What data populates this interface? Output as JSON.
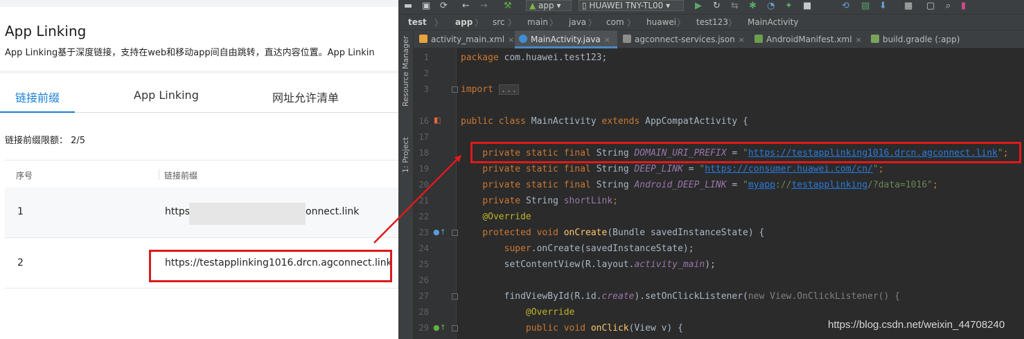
{
  "console": {
    "title": "App Linking",
    "description": "App Linking基于深度链接，支持在web和移动app间自由跳转，直达内容位置。App Linkin",
    "tabs": [
      {
        "label": "链接前缀",
        "active": true
      },
      {
        "label": "App Linking",
        "active": false
      },
      {
        "label": "网址允许清单",
        "active": false
      }
    ],
    "quota_label": "链接前缀限额：",
    "quota_value": "2/5",
    "table": {
      "headers": [
        "序号",
        "链接前缀"
      ],
      "rows": [
        {
          "index": "1",
          "prefix_start": "https:/",
          "prefix_end": "onnect.link"
        },
        {
          "index": "2",
          "prefix": "https://testapplinking1016.drcn.agconnect.link"
        }
      ]
    }
  },
  "ide": {
    "toolbar": {
      "module": "app",
      "device": "HUAWEI TNY-TL00"
    },
    "breadcrumb": [
      "test",
      "app",
      "src",
      "main",
      "java",
      "com",
      "huawei",
      "test123",
      "MainActivity"
    ],
    "sidebar_labels": [
      "Resource Manager",
      "1: Project"
    ],
    "tabs": [
      {
        "label": "activity_main.xml",
        "active": false,
        "icon_color": "#e8a33d"
      },
      {
        "label": "MainActivity.java",
        "active": true,
        "icon_color": "#3f8fd2"
      },
      {
        "label": "agconnect-services.json",
        "active": false,
        "icon_color": "#8c8c8c"
      },
      {
        "label": "AndroidManifest.xml",
        "active": false,
        "icon_color": "#6a9f4f"
      },
      {
        "label": "build.gradle (:app)",
        "active": false,
        "icon_color": "#7aa35a"
      }
    ],
    "line_numbers": [
      "1",
      "2",
      "3",
      "16",
      "17",
      "18",
      "19",
      "20",
      "21",
      "22",
      "23",
      "24",
      "25",
      "26",
      "27",
      "28",
      "29"
    ],
    "code": {
      "package_name": "com.huawei.test123;",
      "import_fold": "...",
      "class_name": "MainActivity",
      "super_class": "AppCompatActivity",
      "domain_const": "DOMAIN_URI_PREFIX",
      "domain_url": "https://testapplinking1016.drcn.agconnect.link",
      "deep_const": "DEEP_LINK",
      "deep_url": "https://consumer.huawei.com/cn/",
      "android_const": "Android_DEEP_LINK",
      "android_scheme": "myapp",
      "android_host": "testapplinking",
      "android_query": "/?data=1016",
      "short_link_field": "shortLink",
      "override": "@Override",
      "on_create": "onCreate",
      "on_create_params": "(Bundle savedInstanceState) {",
      "super_call": "super",
      "super_call_rest": ".onCreate(savedInstanceState);",
      "set_content": "setContentView(R.layout.",
      "layout_name": "activity_main",
      "find_view": "findViewById(R.id.",
      "view_id": "create",
      "listener": ").setOnClickListener(",
      "listener_new": "new View.OnClickListener() {",
      "on_click": "onClick",
      "on_click_params": "(View v) {"
    },
    "watermark": "https://blog.csdn.net/weixin_44708240"
  },
  "colors": {
    "accent_blue": "#1a7fd4",
    "highlight_red": "#d91a1a",
    "ide_background": "#2b2b2b"
  }
}
